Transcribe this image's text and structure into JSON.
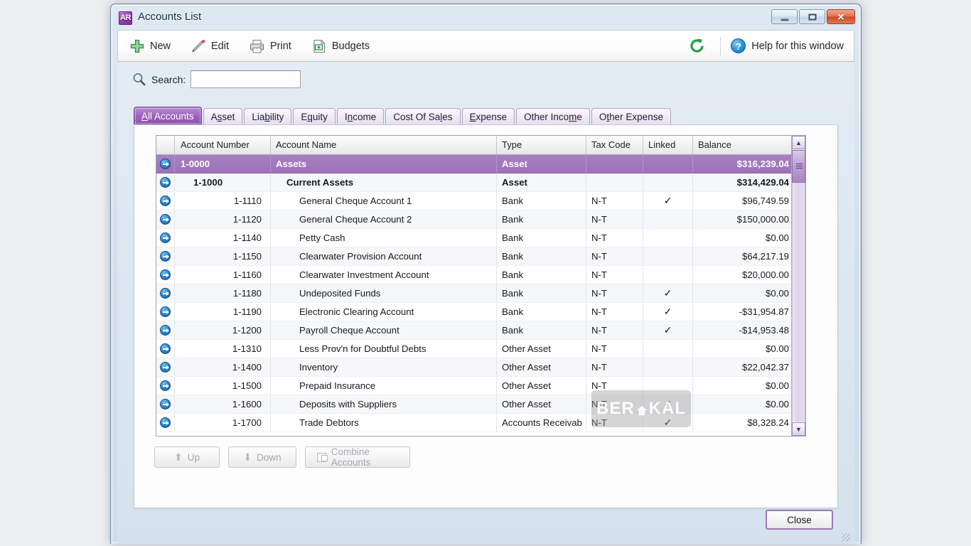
{
  "window": {
    "app_icon_text": "AR",
    "title": "Accounts List",
    "minimize_label": "Minimize",
    "maximize_label": "Maximize",
    "close_label": "✕"
  },
  "toolbar": {
    "new_label": "New",
    "edit_label": "Edit",
    "print_label": "Print",
    "budgets_label": "Budgets",
    "refresh_label": "Refresh",
    "help_badge": "?",
    "help_label": "Help for this window"
  },
  "search": {
    "label": "Search:",
    "value": "",
    "placeholder": ""
  },
  "tabs": [
    {
      "label": "All Accounts",
      "mnemonic": "A",
      "active": true
    },
    {
      "label": "Asset",
      "mnemonic": "s",
      "active": false
    },
    {
      "label": "Liability",
      "mnemonic": "b",
      "active": false
    },
    {
      "label": "Equity",
      "mnemonic": "q",
      "active": false
    },
    {
      "label": "Income",
      "mnemonic": "n",
      "active": false
    },
    {
      "label": "Cost Of Sales",
      "mnemonic": "l",
      "active": false
    },
    {
      "label": "Expense",
      "mnemonic": "E",
      "active": false
    },
    {
      "label": "Other Income",
      "mnemonic": "m",
      "active": false
    },
    {
      "label": "Other Expense",
      "mnemonic": "t",
      "active": false
    }
  ],
  "grid": {
    "columns": [
      "Account Number",
      "Account Name",
      "Type",
      "Tax Code",
      "Linked",
      "Balance"
    ],
    "rows": [
      {
        "number": "1-0000",
        "name": "Assets",
        "type": "Asset",
        "tax": "",
        "linked": "",
        "balance": "$316,239.04",
        "level": 0,
        "selected": true,
        "bold": true
      },
      {
        "number": "1-1000",
        "name": "Current Assets",
        "type": "Asset",
        "tax": "",
        "linked": "",
        "balance": "$314,429.04",
        "level": 1,
        "selected": false,
        "bold": true
      },
      {
        "number": "1-1110",
        "name": "General Cheque Account 1",
        "type": "Bank",
        "tax": "N-T",
        "linked": "✓",
        "balance": "$96,749.59",
        "level": 2,
        "selected": false,
        "bold": false
      },
      {
        "number": "1-1120",
        "name": "General Cheque Account 2",
        "type": "Bank",
        "tax": "N-T",
        "linked": "",
        "balance": "$150,000.00",
        "level": 2,
        "selected": false,
        "bold": false
      },
      {
        "number": "1-1140",
        "name": "Petty Cash",
        "type": "Bank",
        "tax": "N-T",
        "linked": "",
        "balance": "$0.00",
        "level": 2,
        "selected": false,
        "bold": false
      },
      {
        "number": "1-1150",
        "name": "Clearwater Provision Account",
        "type": "Bank",
        "tax": "N-T",
        "linked": "",
        "balance": "$64,217.19",
        "level": 2,
        "selected": false,
        "bold": false
      },
      {
        "number": "1-1160",
        "name": "Clearwater Investment Account",
        "type": "Bank",
        "tax": "N-T",
        "linked": "",
        "balance": "$20,000.00",
        "level": 2,
        "selected": false,
        "bold": false
      },
      {
        "number": "1-1180",
        "name": "Undeposited Funds",
        "type": "Bank",
        "tax": "N-T",
        "linked": "✓",
        "balance": "$0.00",
        "level": 2,
        "selected": false,
        "bold": false
      },
      {
        "number": "1-1190",
        "name": "Electronic Clearing Account",
        "type": "Bank",
        "tax": "N-T",
        "linked": "✓",
        "balance": "-$31,954.87",
        "level": 2,
        "selected": false,
        "bold": false
      },
      {
        "number": "1-1200",
        "name": "Payroll Cheque Account",
        "type": "Bank",
        "tax": "N-T",
        "linked": "✓",
        "balance": "-$14,953.48",
        "level": 2,
        "selected": false,
        "bold": false
      },
      {
        "number": "1-1310",
        "name": "Less Prov'n for Doubtful Debts",
        "type": "Other Asset",
        "tax": "N-T",
        "linked": "",
        "balance": "$0.00",
        "level": 2,
        "selected": false,
        "bold": false
      },
      {
        "number": "1-1400",
        "name": "Inventory",
        "type": "Other Asset",
        "tax": "N-T",
        "linked": "",
        "balance": "$22,042.37",
        "level": 2,
        "selected": false,
        "bold": false
      },
      {
        "number": "1-1500",
        "name": "Prepaid Insurance",
        "type": "Other Asset",
        "tax": "N-T",
        "linked": "",
        "balance": "$0.00",
        "level": 2,
        "selected": false,
        "bold": false
      },
      {
        "number": "1-1600",
        "name": "Deposits with Suppliers",
        "type": "Other Asset",
        "tax": "N-T",
        "linked": "✓",
        "balance": "$0.00",
        "level": 2,
        "selected": false,
        "bold": false
      },
      {
        "number": "1-1700",
        "name": "Trade Debtors",
        "type": "Accounts Receivab",
        "tax": "N-T",
        "linked": "✓",
        "balance": "$8,328.24",
        "level": 2,
        "selected": false,
        "bold": false
      }
    ]
  },
  "footer": {
    "up_label": "Up",
    "down_label": "Down",
    "combine_label": "Combine Accounts",
    "close_label": "Close"
  },
  "watermark": {
    "text_left": "BER",
    "text_right": "KAL"
  },
  "colors": {
    "accent_purple": "#9d72ba",
    "selection_purple": "#a87fc2",
    "link_blue": "#2a7fc4",
    "new_green": "#2e9f4a",
    "close_red": "#cc4a22"
  }
}
